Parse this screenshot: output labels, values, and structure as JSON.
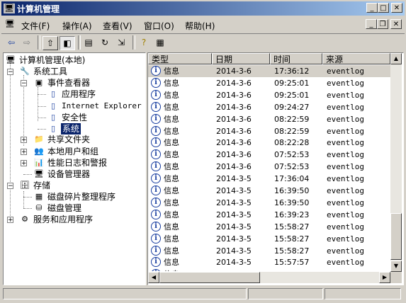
{
  "window": {
    "title": "计算机管理"
  },
  "menu": [
    "文件(F)",
    "操作(A)",
    "查看(V)",
    "窗口(O)",
    "帮助(H)"
  ],
  "tree": {
    "root": "计算机管理(本地)",
    "system_tools": "系统工具",
    "event_viewer": "事件查看器",
    "app": "应用程序",
    "ie": "Internet Explorer",
    "security": "安全性",
    "system": "系统",
    "shared": "共享文件夹",
    "users": "本地用户和组",
    "perf": "性能日志和警报",
    "devmgr": "设备管理器",
    "storage": "存储",
    "defrag": "磁盘碎片整理程序",
    "diskmgmt": "磁盘管理",
    "services": "服务和应用程序"
  },
  "list": {
    "columns": [
      "类型",
      "日期",
      "时间",
      "来源"
    ],
    "rows": [
      [
        "信息",
        "2014-3-6",
        "17:36:12",
        "eventlog"
      ],
      [
        "信息",
        "2014-3-6",
        "09:25:01",
        "eventlog"
      ],
      [
        "信息",
        "2014-3-6",
        "09:25:01",
        "eventlog"
      ],
      [
        "信息",
        "2014-3-6",
        "09:24:27",
        "eventlog"
      ],
      [
        "信息",
        "2014-3-6",
        "08:22:59",
        "eventlog"
      ],
      [
        "信息",
        "2014-3-6",
        "08:22:59",
        "eventlog"
      ],
      [
        "信息",
        "2014-3-6",
        "08:22:28",
        "eventlog"
      ],
      [
        "信息",
        "2014-3-6",
        "07:52:53",
        "eventlog"
      ],
      [
        "信息",
        "2014-3-6",
        "07:52:53",
        "eventlog"
      ],
      [
        "信息",
        "2014-3-5",
        "17:36:04",
        "eventlog"
      ],
      [
        "信息",
        "2014-3-5",
        "16:39:50",
        "eventlog"
      ],
      [
        "信息",
        "2014-3-5",
        "16:39:50",
        "eventlog"
      ],
      [
        "信息",
        "2014-3-5",
        "16:39:23",
        "eventlog"
      ],
      [
        "信息",
        "2014-3-5",
        "15:58:27",
        "eventlog"
      ],
      [
        "信息",
        "2014-3-5",
        "15:58:27",
        "eventlog"
      ],
      [
        "信息",
        "2014-3-5",
        "15:58:27",
        "eventlog"
      ],
      [
        "信息",
        "2014-3-5",
        "15:57:57",
        "eventlog"
      ],
      [
        "信息",
        "",
        "",
        ""
      ]
    ]
  }
}
